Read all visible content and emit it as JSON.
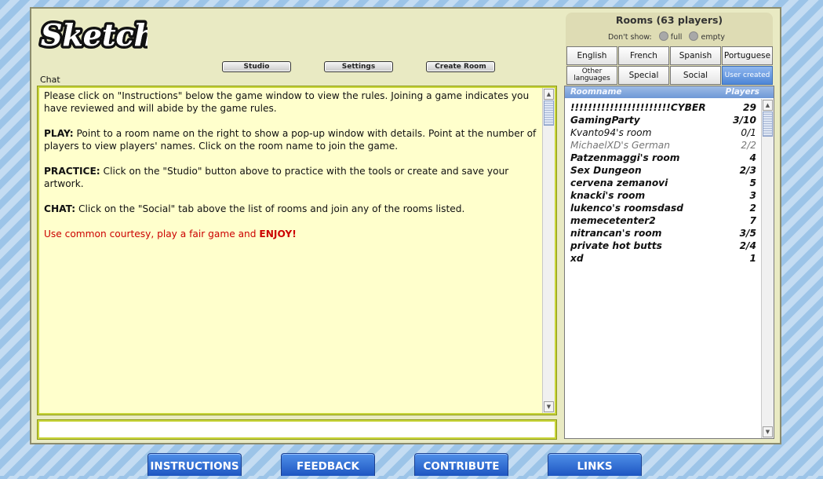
{
  "app": {
    "logo_text": "Sketch"
  },
  "toolbar": {
    "studio": "Studio",
    "settings": "Settings",
    "create_room": "Create Room"
  },
  "chat": {
    "label": "Chat",
    "intro": " Please click on \"Instructions\" below the game window to view the rules. Joining a game indicates you have reviewed and will abide by the game rules.",
    "play_title": "PLAY:",
    "play_text": " Point to a room name on the right to show a pop-up window with details. Point at the number of players to view players' names. Click on the room name to join the game.",
    "practice_title": "PRACTICE:",
    "practice_text": " Click on the \"Studio\" button above to practice with the tools or create and save your artwork.",
    "chat_title": "CHAT:",
    "chat_text": " Click on the \"Social\" tab above the list of rooms and join any of the rooms listed.",
    "courtesy_text": "Use common courtesy, play a fair game and ",
    "courtesy_bold": "ENJOY!",
    "input_value": ""
  },
  "rooms": {
    "title": "Rooms (63 players)",
    "dont_show": "Don't show:",
    "full": "full",
    "empty": "empty",
    "tabs": [
      {
        "label": "English"
      },
      {
        "label": "French"
      },
      {
        "label": "Spanish"
      },
      {
        "label": "Portuguese"
      },
      {
        "label": "Other languages"
      },
      {
        "label": "Special"
      },
      {
        "label": "Social"
      },
      {
        "label": "User created"
      }
    ],
    "column_name": "Roomname",
    "column_players": "Players",
    "list": [
      {
        "name": "!!!!!!!!!!!!!!!!!!!!!!!CYBER",
        "players": "29"
      },
      {
        "name": "GamingParty",
        "players": "3/10"
      },
      {
        "name": "Kvanto94's room",
        "players": "0/1"
      },
      {
        "name": "MichaelXD's German",
        "players": "2/2"
      },
      {
        "name": "Patzenmaggi's room",
        "players": "4"
      },
      {
        "name": "Sex Dungeon",
        "players": "2/3"
      },
      {
        "name": "cervena zemanovi",
        "players": "5"
      },
      {
        "name": "knacki's room",
        "players": "3"
      },
      {
        "name": "lukenco's roomsdasd",
        "players": "2"
      },
      {
        "name": "memecetenter2",
        "players": "7"
      },
      {
        "name": "nitrancan's room",
        "players": "3/5"
      },
      {
        "name": "private hot butts",
        "players": "2/4"
      },
      {
        "name": "xd",
        "players": "1"
      }
    ]
  },
  "footer": {
    "instructions": "INSTRUCTIONS",
    "feedback": "FEEDBACK",
    "contribute": "CONTRIBUTE",
    "links": "LINKS"
  }
}
